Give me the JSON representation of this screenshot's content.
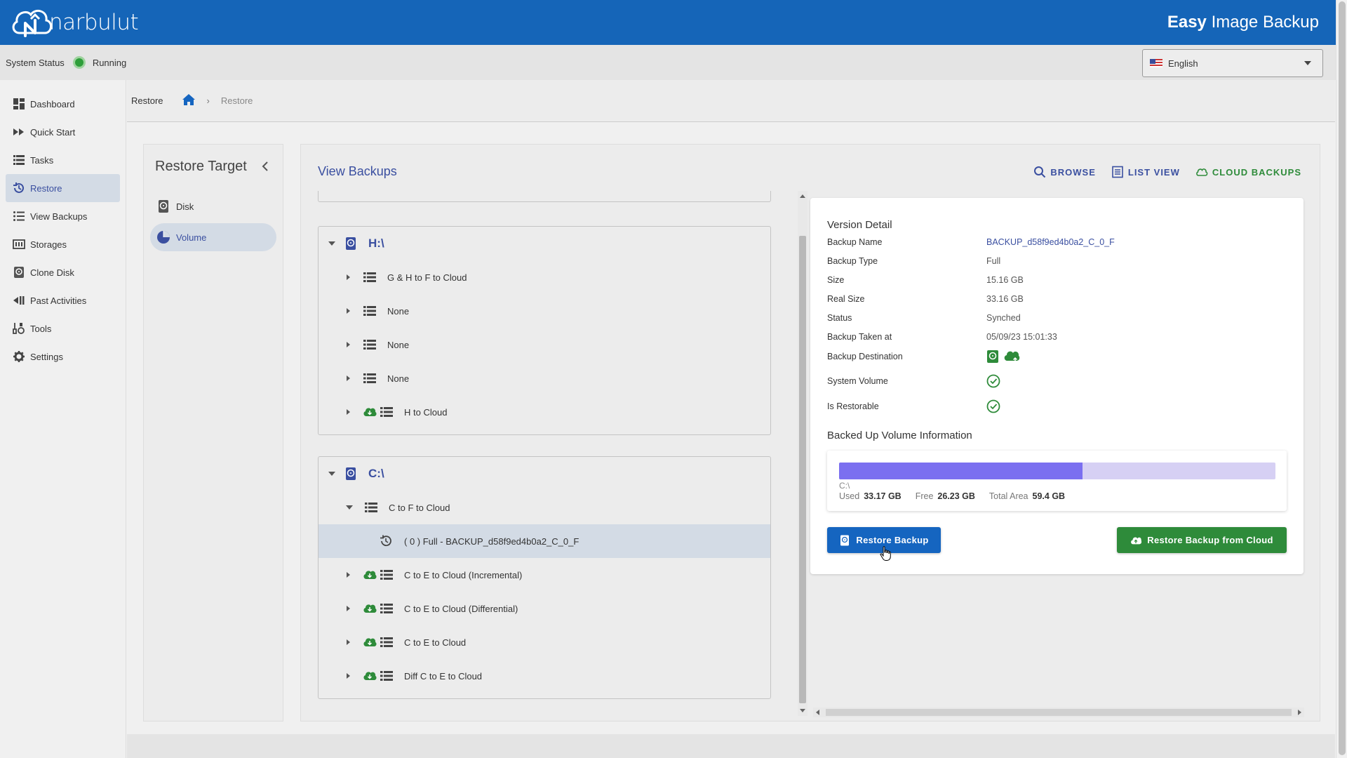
{
  "brand": {
    "logo_text": "narbulut",
    "product_bold": "Easy",
    "product_rest": " Image Backup",
    "primary_color": "#1565b8"
  },
  "status": {
    "label": "System Status",
    "value": "Running",
    "color": "#2e9e3a"
  },
  "language": {
    "selected": "English"
  },
  "sidebar": {
    "items": [
      {
        "label": "Dashboard",
        "icon": "dashboard-icon"
      },
      {
        "label": "Quick Start",
        "icon": "fast-forward-icon"
      },
      {
        "label": "Tasks",
        "icon": "list-icon"
      },
      {
        "label": "Restore",
        "icon": "restore-icon",
        "active": true
      },
      {
        "label": "View Backups",
        "icon": "list-bullets-icon"
      },
      {
        "label": "Storages",
        "icon": "storage-icon"
      },
      {
        "label": "Clone Disk",
        "icon": "disk-icon"
      },
      {
        "label": "Past Activities",
        "icon": "rewind-icon"
      },
      {
        "label": "Tools",
        "icon": "tools-icon"
      },
      {
        "label": "Settings",
        "icon": "gear-icon"
      }
    ]
  },
  "breadcrumb": {
    "title": "Restore",
    "current": "Restore"
  },
  "restore_target": {
    "title": "Restore Target",
    "items": [
      {
        "label": "Disk"
      },
      {
        "label": "Volume",
        "active": true
      }
    ]
  },
  "view_backups": {
    "title": "View Backups",
    "toolbar": {
      "browse": "BROWSE",
      "list_view": "LIST VIEW",
      "cloud_backups": "CLOUD BACKUPS"
    }
  },
  "tree": {
    "groups": [
      {
        "drive": "H:\\",
        "tasks": [
          {
            "label": "G & H to F to Cloud",
            "cloud": false
          },
          {
            "label": "None",
            "cloud": false
          },
          {
            "label": "None",
            "cloud": false
          },
          {
            "label": "None",
            "cloud": false
          },
          {
            "label": "H to Cloud",
            "cloud": true
          }
        ]
      },
      {
        "drive": "C:\\",
        "tasks": [
          {
            "label": "C to F to Cloud",
            "cloud": false,
            "expanded": true
          },
          {
            "label": "( 0 ) Full - BACKUP_d58f9ed4b0a2_C_0_F",
            "version": true,
            "selected": true
          },
          {
            "label": "C to E to Cloud (Incremental)",
            "cloud": true
          },
          {
            "label": "C to E to Cloud (Differential)",
            "cloud": true
          },
          {
            "label": "C to E to Cloud",
            "cloud": true
          },
          {
            "label": "Diff C to E to Cloud",
            "cloud": true
          }
        ]
      }
    ]
  },
  "version_detail": {
    "title": "Version Detail",
    "rows": [
      {
        "key": "Backup Name",
        "value": "BACKUP_d58f9ed4b0a2_C_0_F"
      },
      {
        "key": "Backup Type",
        "value": "Full"
      },
      {
        "key": "Size",
        "value": "15.16 GB"
      },
      {
        "key": "Real Size",
        "value": "33.16 GB"
      },
      {
        "key": "Status",
        "value": "Synched"
      },
      {
        "key": "Backup Taken at",
        "value": "05/09/23 15:01:33"
      },
      {
        "key": "Backup Destination",
        "value": ""
      },
      {
        "key": "System Volume",
        "value": ""
      },
      {
        "key": "Is Restorable",
        "value": ""
      }
    ],
    "volume_info": {
      "title": "Backed Up Volume Information",
      "drive": "C:\\",
      "used_label": "Used",
      "used": "33.17 GB",
      "free_label": "Free",
      "free": "26.23 GB",
      "total_label": "Total Area",
      "total": "59.4 GB",
      "used_fraction": 0.5584
    },
    "restore_button": "Restore Backup",
    "restore_cloud_button": "Restore Backup from Cloud"
  }
}
